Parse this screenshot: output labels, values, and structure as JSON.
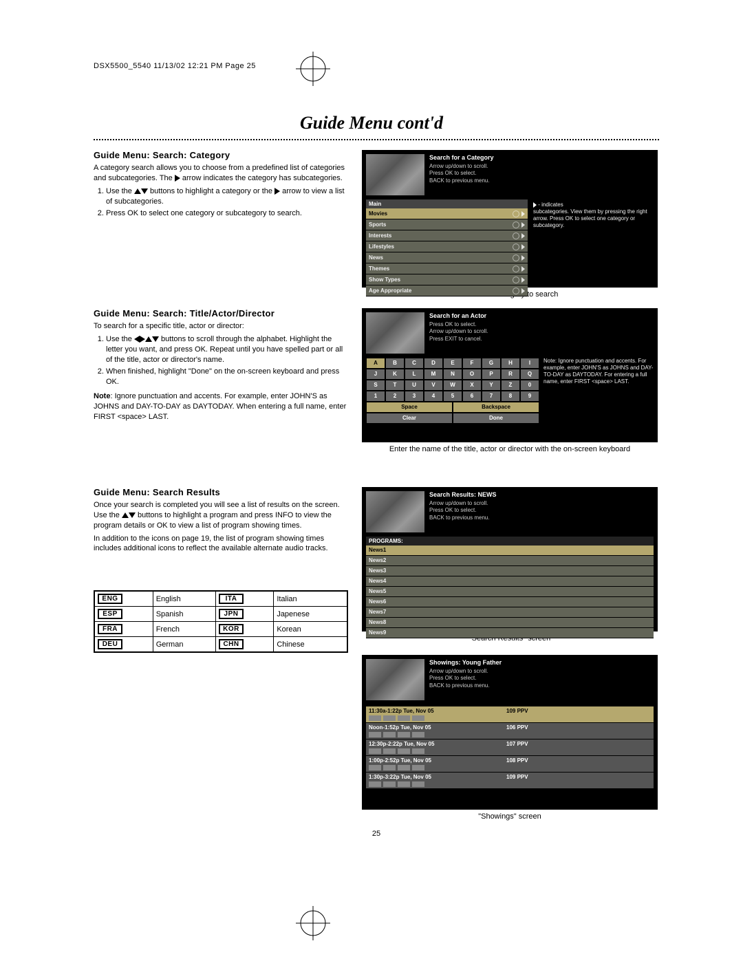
{
  "header_line": "DSX5500_5540  11/13/02  12:21 PM  Page 25",
  "title": "Guide Menu cont'd",
  "page_number": "25",
  "section1": {
    "heading": "Guide Menu: Search: Category",
    "intro_a": "A category search allows you to choose from a predefined list of categories and subcategories. The ",
    "intro_b": " arrow indicates the category has subcategories.",
    "li1a": "Use the ",
    "li1b": " buttons to highlight a category or the ",
    "li1c": " arrow to view a list of subcategories.",
    "li2": "Press OK to select one category or subcategory to search."
  },
  "screenshot1": {
    "title": "Search for a Category",
    "l1": "Arrow up/down to scroll.",
    "l2": "Press OK to select.",
    "l3": "BACK to previous menu.",
    "main": "Main",
    "cats": [
      "Movies",
      "Sports",
      "Interests",
      "Lifestyles",
      "News",
      "Themes",
      "Show Types",
      "Age Appropriate"
    ],
    "note1": " - indicates",
    "note2": "subcategories. View them by pressing the right arrow. Press OK to select one category or subcategory.",
    "caption": "Choose a category to search"
  },
  "section2": {
    "heading": "Guide Menu: Search: Title/Actor/Director",
    "intro": "To search for a specific title, actor or director:",
    "li1a": "Use the ",
    "li1b": " buttons to scroll through the alphabet. Highlight the letter you want, and press OK. Repeat until you have spelled part or all of the title, actor or director's name.",
    "li2": "When finished, highlight \"Done\" on the on-screen keyboard and press OK.",
    "note_label": "Note",
    "note": ": Ignore punctuation and accents. For example, enter JOHN'S as JOHNS and DAY-TO-DAY as DAYTODAY. When entering a full name, enter FIRST <space> LAST."
  },
  "screenshot2": {
    "title": "Search for an Actor",
    "l1": "Press OK to select.",
    "l2": "Arrow up/down to scroll.",
    "l3": "Press EXIT to cancel.",
    "rows": [
      [
        "A",
        "B",
        "C",
        "D",
        "E",
        "F",
        "G",
        "H",
        "I"
      ],
      [
        "J",
        "K",
        "L",
        "M",
        "N",
        "O",
        "P",
        "R",
        "Q"
      ],
      [
        "S",
        "T",
        "U",
        "V",
        "W",
        "X",
        "Y",
        "Z",
        "0"
      ],
      [
        "1",
        "2",
        "3",
        "4",
        "5",
        "6",
        "7",
        "8",
        "9"
      ]
    ],
    "space": "Space",
    "backspace": "Backspace",
    "clear": "Clear",
    "done": "Done",
    "note": "Note: Ignore punctuation and accents. For example, enter JOHN'S as JOHNS and DAY-TO-DAY as DAYTODAY. For entering a full name, enter FIRST <space> LAST.",
    "caption": "Enter the name of the title, actor or director with the on-screen keyboard"
  },
  "section3": {
    "heading": "Guide Menu: Search Results",
    "intro_a": "Once your search is completed you will see a list of results on the screen. Use the ",
    "intro_b": " buttons to highlight a program and press INFO to view the program details or OK to view a list of program showing times.",
    "intro2": "In addition to the icons on page 19, the list of program showing times includes additional icons to reflect the available alternate audio tracks."
  },
  "lang": {
    "eng_code": "ENG",
    "eng": "English",
    "esp_code": "ESP",
    "esp": "Spanish",
    "fra_code": "FRA",
    "fra": "French",
    "deu_code": "DEU",
    "deu": "German",
    "ita_code": "ITA",
    "ita": "Italian",
    "jpn_code": "JPN",
    "jpn": "Japenese",
    "kor_code": "KOR",
    "kor": "Korean",
    "chn_code": "CHN",
    "chn": "Chinese"
  },
  "screenshot3": {
    "title": "Search Results: NEWS",
    "l1": "Arrow up/down to scroll.",
    "l2": "Press OK to select.",
    "l3": "BACK to previous menu.",
    "programs": "PROGRAMS:",
    "rows": [
      "News1",
      "News2",
      "News3",
      "News4",
      "News5",
      "News6",
      "News7",
      "News8",
      "News9"
    ],
    "caption": "\"Search Results\" screen"
  },
  "screenshot4": {
    "title": "Showings: Young Father",
    "l1": "Arrow up/down to scroll.",
    "l2": "Press OK to select.",
    "l3": "BACK to previous menu.",
    "rows": [
      {
        "time": "11:30a-1:22p Tue, Nov 05",
        "ch": "109 PPV"
      },
      {
        "time": "Noon-1:52p Tue, Nov 05",
        "ch": "106 PPV"
      },
      {
        "time": "12:30p-2:22p Tue, Nov 05",
        "ch": "107 PPV"
      },
      {
        "time": "1:00p-2:52p Tue, Nov 05",
        "ch": "108 PPV"
      },
      {
        "time": "1:30p-3:22p Tue, Nov 05",
        "ch": "109 PPV"
      }
    ],
    "caption": "\"Showings\" screen"
  }
}
